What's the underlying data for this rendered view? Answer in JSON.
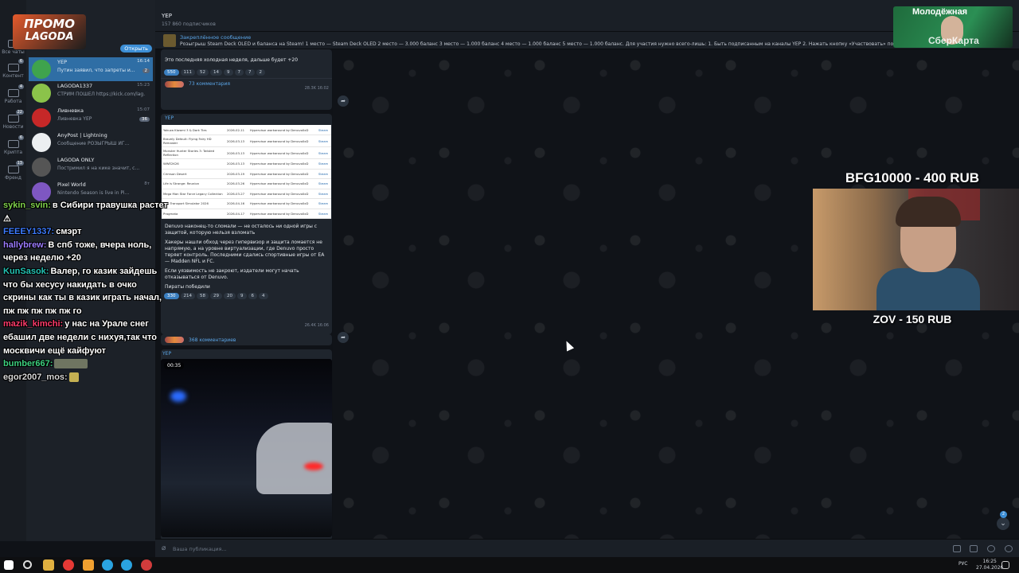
{
  "rail": [
    {
      "label": "Все чаты",
      "count": ""
    },
    {
      "label": "Контент",
      "count": "6"
    },
    {
      "label": "Работа",
      "count": "4"
    },
    {
      "label": "Новости",
      "count": "22"
    },
    {
      "label": "Крипта",
      "count": "6"
    },
    {
      "label": "Френд",
      "count": "13"
    }
  ],
  "promo": {
    "line1": "ПРОМО",
    "line2": "LAGODA"
  },
  "chats": [
    {
      "name": "YEP",
      "preview": "Путин заявил, что запреты и...",
      "time": "16:14",
      "badge": "2",
      "active": true
    },
    {
      "name": "LAGODA1337",
      "preview": "СТРИМ ПОШЕЛ https://kick.com/lag...",
      "time": "15:23",
      "badge": "",
      "active": false
    },
    {
      "name": "Ливневка",
      "preview": "Ливневка YEP",
      "time": "15:07",
      "badge": "36",
      "active": false
    },
    {
      "name": "AnyPost | Lightning",
      "preview": "Сообщение РОЗЫГРЫШ ИГ...",
      "time": "",
      "badge": "",
      "active": false
    },
    {
      "name": "LAGODA ONLY",
      "preview": "Постримил я на кике значит, с...",
      "time": "",
      "badge": "",
      "active": false
    },
    {
      "name": "Pixel World",
      "preview": "Nintendo Season is live in Pi...",
      "time": "8т",
      "badge": "",
      "active": false
    }
  ],
  "chat_open_label": "Открыть",
  "header": {
    "title": "YEP",
    "subscribers": "157 860 подписчиков"
  },
  "pinned": {
    "label": "Закреплённое сообщение",
    "text": "Розыгрыш Steam Deck OLED и баланса на Steam! 1 место — Steam Deck OLED 2 место — 3.000 баланс 3 место — 1.000 баланс 4 место — 1.000 баланс 5 место — 1.000 баланс. Для участия нужно всего-лишь: 1. Быть подписанным на каналы YEP 2. Нажать кнопку «Участвовать» под эт"
  },
  "post1": {
    "text": "Это последняя холодная неделя, дальше будет +20",
    "reactions": [
      "550",
      "111",
      "52",
      "14",
      "9",
      "7",
      "7",
      "2"
    ],
    "views": "28.3K 16:02",
    "comments": "73 комментария"
  },
  "post2": {
    "channel": "YEP",
    "games": [
      [
        "Yakuza Kiwami 3 & Dark Ties",
        "2026-02-11",
        "Hypervisor workaround by Denuvo0xD",
        "Steam"
      ],
      [
        "Bravely Default: Flying Fairy HD Remaster",
        "2026-03-13",
        "Hypervisor workaround by Denuvo0xD",
        "Steam"
      ],
      [
        "Monster Hunter Stories 3: Twisted Reflection",
        "2026-03-13",
        "Hypervisor workaround by Denuvo0xD",
        "Steam"
      ],
      [
        "WWE2K26",
        "2026-03-13",
        "Hypervisor workaround by Denuvo0xD",
        "Steam"
      ],
      [
        "Crimson Desert",
        "2026-03-19",
        "Hypervisor workaround by Denuvo0xD",
        "Steam"
      ],
      [
        "Life is Strange: Reunion",
        "2026-03-26",
        "Hypervisor workaround by Denuvo0xD",
        "Steam"
      ],
      [
        "Mega Man Star Force Legacy Collection",
        "2026-03-27",
        "Hypervisor workaround by Denuvo0xD",
        "Steam"
      ],
      [
        "City Transport Simulator 2026",
        "2026-04-16",
        "Hypervisor workaround by Denuvo0xD",
        "Steam"
      ],
      [
        "Pragmata",
        "2026-04-17",
        "Hypervisor workaround by Denuvo0xD",
        "Steam"
      ]
    ],
    "p1": "Denuvo наконец-то сломали — не осталось ни одной игры с защитой, которую нельзя взломать",
    "p2": "Хакеры нашли обход через гипервизор и защита ломается не напрямую, а на уровне виртуализации, где Denuvo просто теряет контроль. Последними сдались спортивные игры от EA — Madden NFL и FC.",
    "p3": "Если уязвимость не закроют, издатели могут начать отказываться от Denuvo.",
    "p4": "Пираты победили",
    "reactions": [
      "330",
      "214",
      "58",
      "29",
      "20",
      "9",
      "6",
      "4"
    ],
    "views": "26.4K 16:06",
    "comments": "368 комментариев"
  },
  "post3": {
    "channel": "YEP",
    "duration": "00:35"
  },
  "composer": {
    "placeholder": "Ваша публикация..."
  },
  "twitch_chat": [
    {
      "user": "sykin_svin:",
      "color": "#7fd14b",
      "text": "в Сибири травушка растет ⚠"
    },
    {
      "user": "FEEEY1337:",
      "color": "#3d7cff",
      "text": "смэрт"
    },
    {
      "user": "hallybrew:",
      "color": "#9b7bff",
      "text": "В спб тоже, вчера ноль, через неделю +20"
    },
    {
      "user": "KunSasok:",
      "color": "#23c2b3",
      "text": "Валер, го казик зайдешь что бы хесусу накидать в очко скрины как ты в казик играть начал, пж пж пж пж пж го"
    },
    {
      "user": "mazik_kimchi:",
      "color": "#ff3b6b",
      "text": "у нас на Урале снег ебашил две недели с нихуя,так что москвичи ещё кайфуют"
    },
    {
      "user": "bumber667:",
      "color": "#3dd17f",
      "text": ""
    },
    {
      "user": "egor2007_mos:",
      "color": "#d6d6d6",
      "text": ""
    }
  ],
  "donation": {
    "top": "BFG10000 - 400 RUB",
    "bottom": "ZOV - 150 RUB"
  },
  "ad": {
    "title": "Молодёжная",
    "brand": "СберКарта"
  },
  "scroll_badge": "2",
  "tray": {
    "lang": "РУС",
    "time": "16:25",
    "date": "27.04.2026"
  }
}
